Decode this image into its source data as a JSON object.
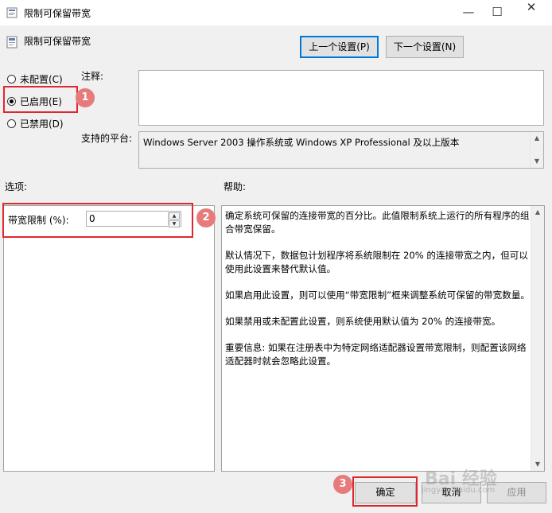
{
  "window": {
    "title": "限制可保留带宽",
    "controls": {
      "minimize": "—",
      "maximize": "☐",
      "close": "✕"
    }
  },
  "header": {
    "title": "限制可保留带宽",
    "prev_button": "上一个设置(P)",
    "next_button": "下一个设置(N)"
  },
  "state": {
    "options": [
      {
        "label": "未配置(C)",
        "selected": false
      },
      {
        "label": "已启用(E)",
        "selected": true
      },
      {
        "label": "已禁用(D)",
        "selected": false
      }
    ]
  },
  "comment": {
    "label": "注释:",
    "value": ""
  },
  "platform": {
    "label": "支持的平台:",
    "value": "Windows Server 2003 操作系统或 Windows XP Professional 及以上版本"
  },
  "options_section": {
    "label": "选项:",
    "bandwidth_label": "带宽限制 (%):",
    "bandwidth_value": "0"
  },
  "help_section": {
    "label": "帮助:",
    "paragraphs": [
      "确定系统可保留的连接带宽的百分比。此值限制系统上运行的所有程序的组合带宽保留。",
      "默认情况下，数据包计划程序将系统限制在 20% 的连接带宽之内，但可以使用此设置来替代默认值。",
      "如果启用此设置，则可以使用“带宽限制”框来调整系统可保留的带宽数量。",
      "如果禁用或未配置此设置，则系统使用默认值为 20% 的连接带宽。",
      "重要信息: 如果在注册表中为特定网络适配器设置带宽限制，则配置该网络适配器时就会忽略此设置。"
    ]
  },
  "footer": {
    "ok_button": "确定",
    "cancel_button": "取消",
    "apply_button": "应用"
  },
  "annotations": {
    "badge1": "1",
    "badge2": "2",
    "badge3": "3",
    "highlight_color": "#e0272e",
    "badge_color": "#e77b7b"
  },
  "watermark": {
    "text": "Bai 经验",
    "subtext": "jingyan.baidu.com"
  }
}
